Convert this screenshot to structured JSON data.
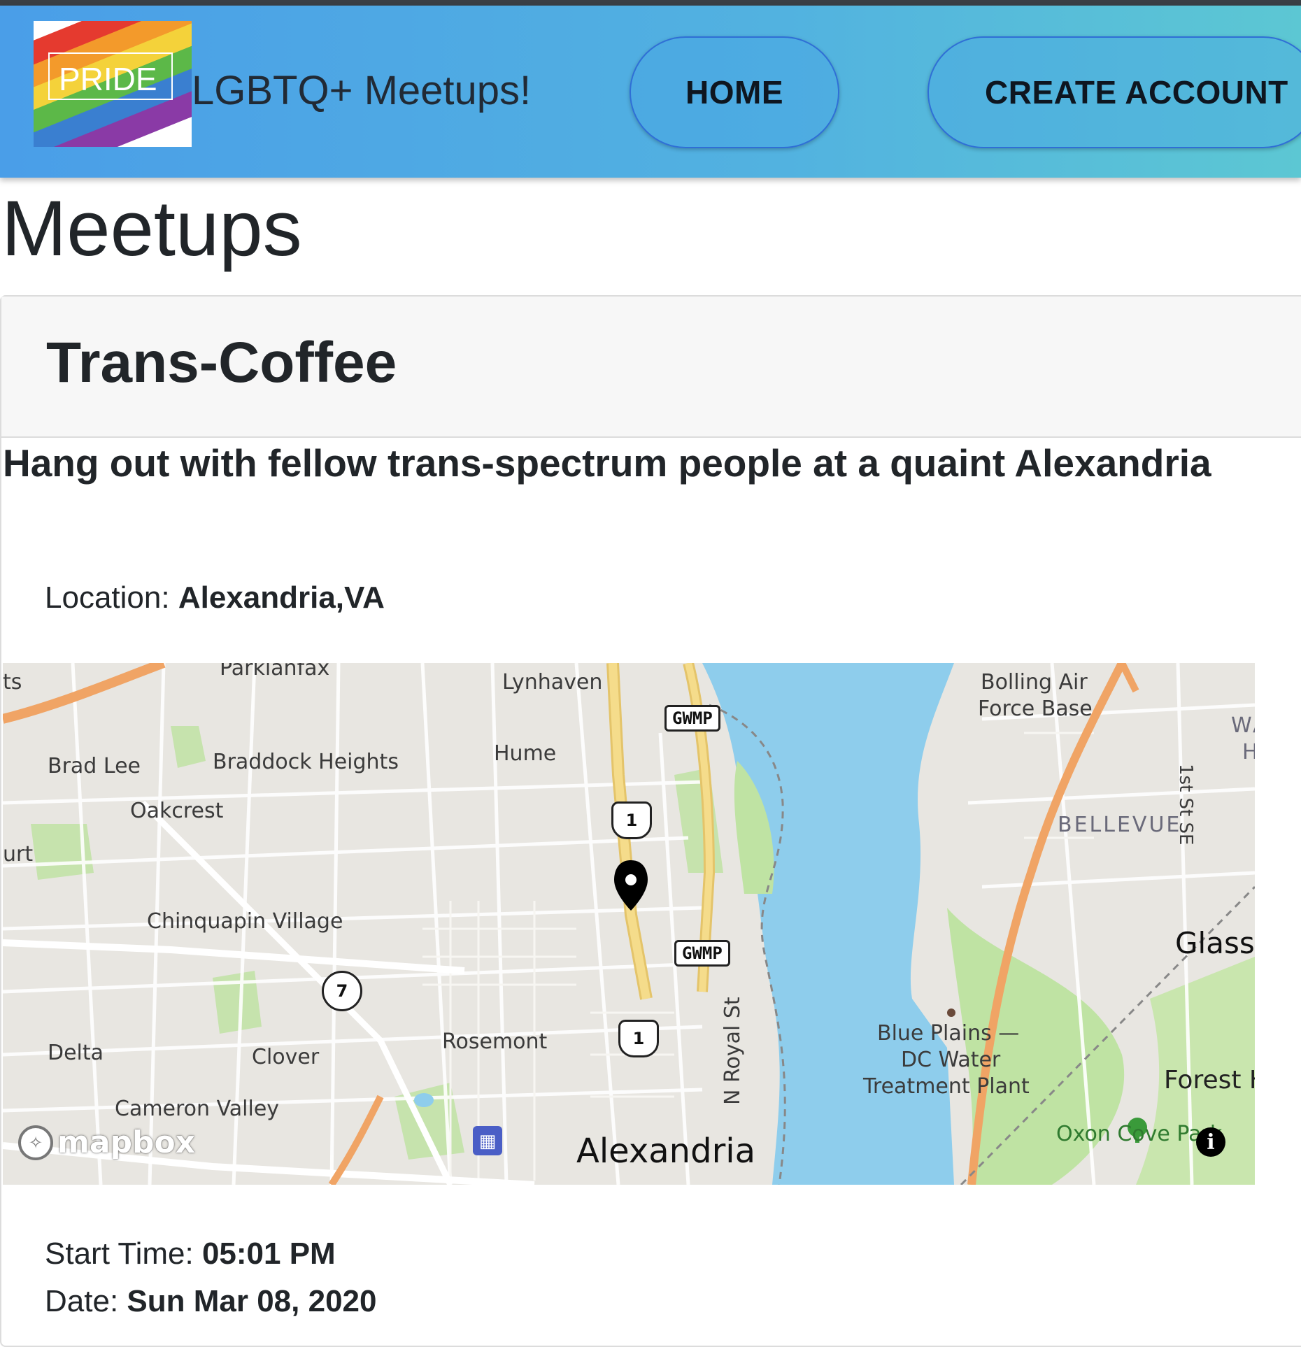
{
  "navbar": {
    "logo_text": "PRIDE",
    "brand": "LGBTQ+ Meetups!",
    "links": [
      {
        "label": "HOME"
      },
      {
        "label": "CREATE ACCOUNT"
      }
    ]
  },
  "page": {
    "title": "Meetups"
  },
  "meetup": {
    "title": "Trans-Coffee",
    "description": "Hang out with fellow trans-spectrum people at a quaint Alexandria",
    "location_label": "Location:",
    "location_value": "Alexandria,VA",
    "start_label": "Start Time:",
    "start_value": "05:01 PM",
    "date_label": "Date:",
    "date_value": "Sun Mar 08, 2020"
  },
  "map": {
    "labels": {
      "parklawn": "Parklanfax",
      "ts": "ts",
      "lynhaven": "Lynhaven",
      "bolling": "Bolling Air",
      "force_base": "Force Base",
      "brad_lee": "Brad Lee",
      "braddock": "Braddock Heights",
      "hume": "Hume",
      "oakcrest": "Oakcrest",
      "urt": "urt",
      "chinquapin": "Chinquapin Village",
      "bellevue": "BELLEVUE",
      "glass": "Glass",
      "delta": "Delta",
      "clover": "Clover",
      "rosemont": "Rosemont",
      "royal": "N Royal St",
      "blue_plains_1": "Blue Plains —",
      "blue_plains_2": "DC Water",
      "blue_plains_3": "Treatment Plant",
      "forest": "Forest H",
      "cameron": "Cameron Valley",
      "alexandria": "Alexandria",
      "oxon": "Oxon Cove Park",
      "first_st": "1st St SE",
      "wa": "WA",
      "h": "H"
    },
    "shields": {
      "us1": "1",
      "va7": "7",
      "gwmp": "GWMP"
    },
    "attribution": "mapbox",
    "info": "i"
  }
}
